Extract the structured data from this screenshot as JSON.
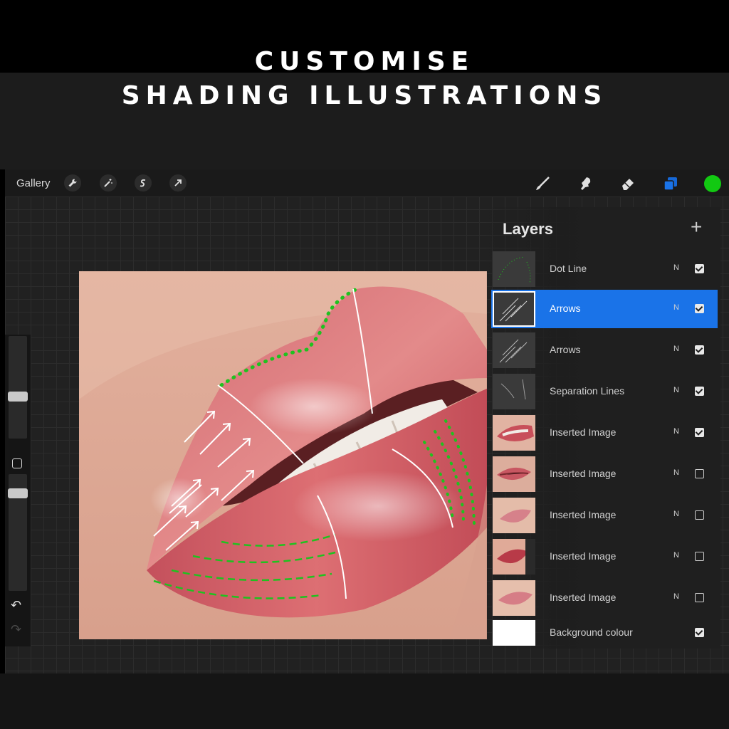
{
  "heading": {
    "line1": "CUSTOMISE",
    "line2": "SHADING ILLUSTRATIONS"
  },
  "toolbar": {
    "gallery_label": "Gallery",
    "left_icons": [
      "wrench-icon",
      "magic-wand-icon",
      "selection-s-icon",
      "transform-arrow-icon"
    ],
    "right_icons": [
      "brush-icon",
      "smudge-icon",
      "eraser-icon",
      "layers-icon"
    ],
    "active_color": "#12c912",
    "layers_icon_color": "#1a73e8"
  },
  "layers_panel": {
    "title": "Layers",
    "add_label": "+",
    "selected_color": "#1a73e8",
    "items": [
      {
        "name": "Dot Line",
        "mode": "N",
        "visible": true,
        "selected": false
      },
      {
        "name": "Arrows",
        "mode": "N",
        "visible": true,
        "selected": true
      },
      {
        "name": "Arrows",
        "mode": "N",
        "visible": true,
        "selected": false
      },
      {
        "name": "Separation Lines",
        "mode": "N",
        "visible": true,
        "selected": false
      },
      {
        "name": "Inserted Image",
        "mode": "N",
        "visible": true,
        "selected": false
      },
      {
        "name": "Inserted Image",
        "mode": "N",
        "visible": false,
        "selected": false
      },
      {
        "name": "Inserted Image",
        "mode": "N",
        "visible": false,
        "selected": false
      },
      {
        "name": "Inserted Image",
        "mode": "N",
        "visible": false,
        "selected": false
      },
      {
        "name": "Inserted Image",
        "mode": "N",
        "visible": false,
        "selected": false
      }
    ],
    "background": {
      "name": "Background colour",
      "visible": true
    }
  },
  "sidebar": {
    "undo_icon": "undo-icon",
    "redo_icon": "redo-icon"
  },
  "overlay_colors": {
    "dot_line": "#1fc21f",
    "arrows": "#ffffff",
    "separation_lines": "#ffffff"
  }
}
